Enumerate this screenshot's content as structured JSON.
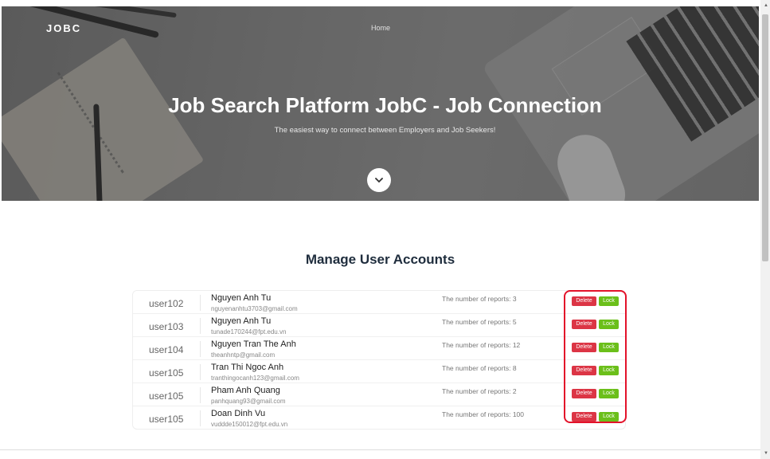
{
  "header": {
    "brand": "JOBC",
    "nav_home": "Home"
  },
  "hero": {
    "title": "Job Search Platform JobC - Job Connection",
    "subtitle": "The easiest way to connect between Employers and Job Seekers!",
    "scroll_icon": "chevron-down-icon"
  },
  "section": {
    "title": "Manage User Accounts"
  },
  "buttons": {
    "delete_label": "Delete",
    "lock_label": "Lock"
  },
  "users": [
    {
      "id": "user102",
      "name": "Nguyen Anh Tu",
      "email": "nguyenanhtu3703@gmail.com",
      "reports": "The number of reports: 3"
    },
    {
      "id": "user103",
      "name": "Nguyen Anh Tu",
      "email": "tunade170244@fpt.edu.vn",
      "reports": "The number of reports: 5"
    },
    {
      "id": "user104",
      "name": "Nguyen Tran The Anh",
      "email": "theanhntp@gmail.com",
      "reports": "The number of reports: 12"
    },
    {
      "id": "user105",
      "name": "Tran Thi Ngoc Anh",
      "email": "tranthingocanh123@gmail.com",
      "reports": "The number of reports: 8"
    },
    {
      "id": "user105",
      "name": "Pham Anh Quang",
      "email": "panhquang93@gmail.com",
      "reports": "The number of reports: 2"
    },
    {
      "id": "user105",
      "name": "Doan Dinh Vu",
      "email": "vuddde150012@fpt.edu.vn",
      "reports": "The number of reports: 100"
    }
  ],
  "colors": {
    "delete": "#dc3545",
    "lock": "#6bbf1a",
    "highlight": "#e3122a"
  }
}
